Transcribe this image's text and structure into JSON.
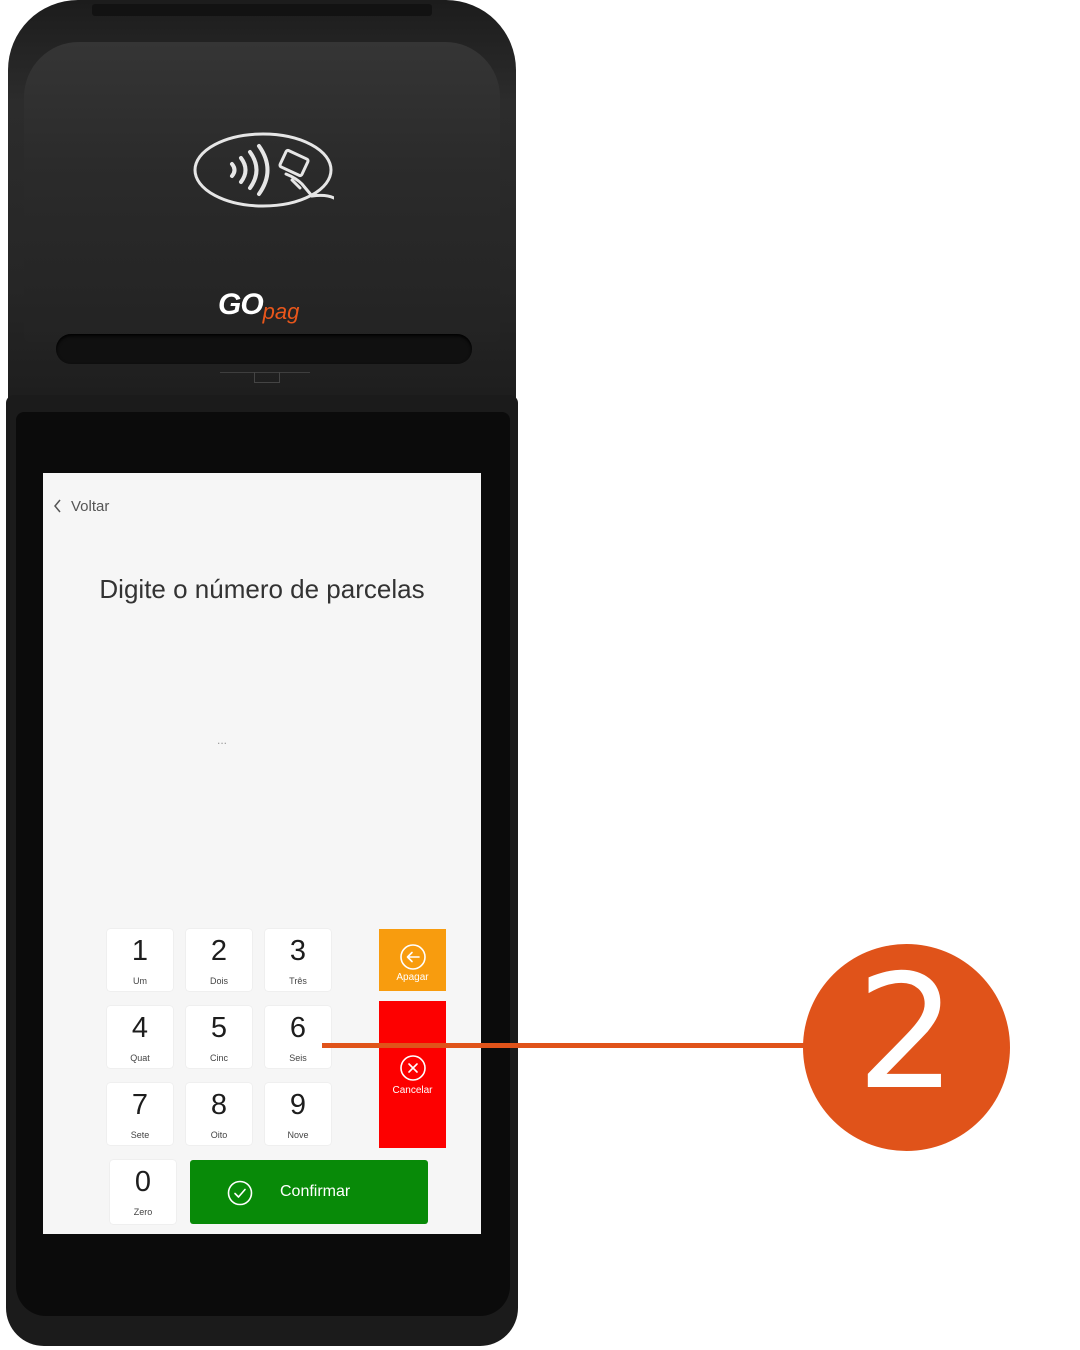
{
  "device": {
    "brand_go": "GO",
    "brand_pag": "pag"
  },
  "screen": {
    "back_label": "Voltar",
    "title": "Digite o número de parcelas",
    "display_value": "...",
    "keys": [
      {
        "num": "1",
        "word": "Um"
      },
      {
        "num": "2",
        "word": "Dois"
      },
      {
        "num": "3",
        "word": "Três"
      },
      {
        "num": "4",
        "word": "Quat"
      },
      {
        "num": "5",
        "word": "Cinc"
      },
      {
        "num": "6",
        "word": "Seis"
      },
      {
        "num": "7",
        "word": "Sete"
      },
      {
        "num": "8",
        "word": "Oito"
      },
      {
        "num": "9",
        "word": "Nove"
      },
      {
        "num": "0",
        "word": "Zero"
      }
    ],
    "apagar_label": "Apagar",
    "cancelar_label": "Cancelar",
    "confirmar_label": "Confirmar"
  },
  "callout": {
    "number": "2"
  },
  "colors": {
    "apagar": "#f89c0e",
    "cancelar": "#fd0000",
    "confirmar": "#088a08",
    "callout": "#e0531a"
  }
}
